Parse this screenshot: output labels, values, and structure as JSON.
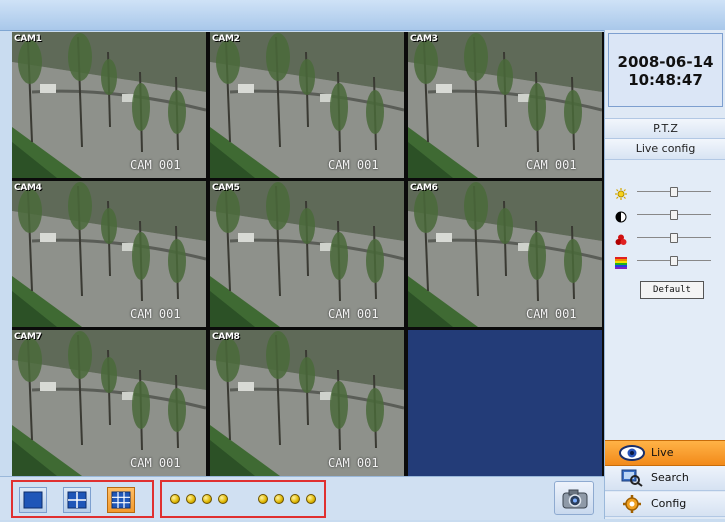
{
  "datetime": {
    "date": "2008-06-14",
    "time": "10:48:47"
  },
  "panel": {
    "ptz_label": "P.T.Z",
    "live_config_label": "Live config",
    "default_label": "Default"
  },
  "sliders": [
    {
      "icon": "brightness-icon",
      "level": 0.5
    },
    {
      "icon": "contrast-icon",
      "level": 0.5
    },
    {
      "icon": "color-icon",
      "level": 0.5
    },
    {
      "icon": "saturation-icon",
      "level": 0.5
    }
  ],
  "nav": {
    "live": "Live",
    "search": "Search",
    "config": "Config"
  },
  "cameras": [
    {
      "label": "CAM1",
      "id_text": "CAM 001",
      "selected": true
    },
    {
      "label": "CAM2",
      "id_text": "CAM 001"
    },
    {
      "label": "CAM3",
      "id_text": "CAM 001"
    },
    {
      "label": "CAM4",
      "id_text": "CAM 001"
    },
    {
      "label": "CAM5",
      "id_text": "CAM 001"
    },
    {
      "label": "CAM6",
      "id_text": "CAM 001"
    },
    {
      "label": "CAM7",
      "id_text": "CAM 001"
    },
    {
      "label": "CAM8",
      "id_text": "CAM 001"
    }
  ],
  "layout_buttons": [
    {
      "icon": "single-view-icon"
    },
    {
      "icon": "quad-view-icon"
    },
    {
      "icon": "nine-view-icon",
      "active": true
    }
  ],
  "channel_dots": 8,
  "colors": {
    "accent": "#f28a1a",
    "selection": "#e03030",
    "empty_cell": "#233c78"
  }
}
